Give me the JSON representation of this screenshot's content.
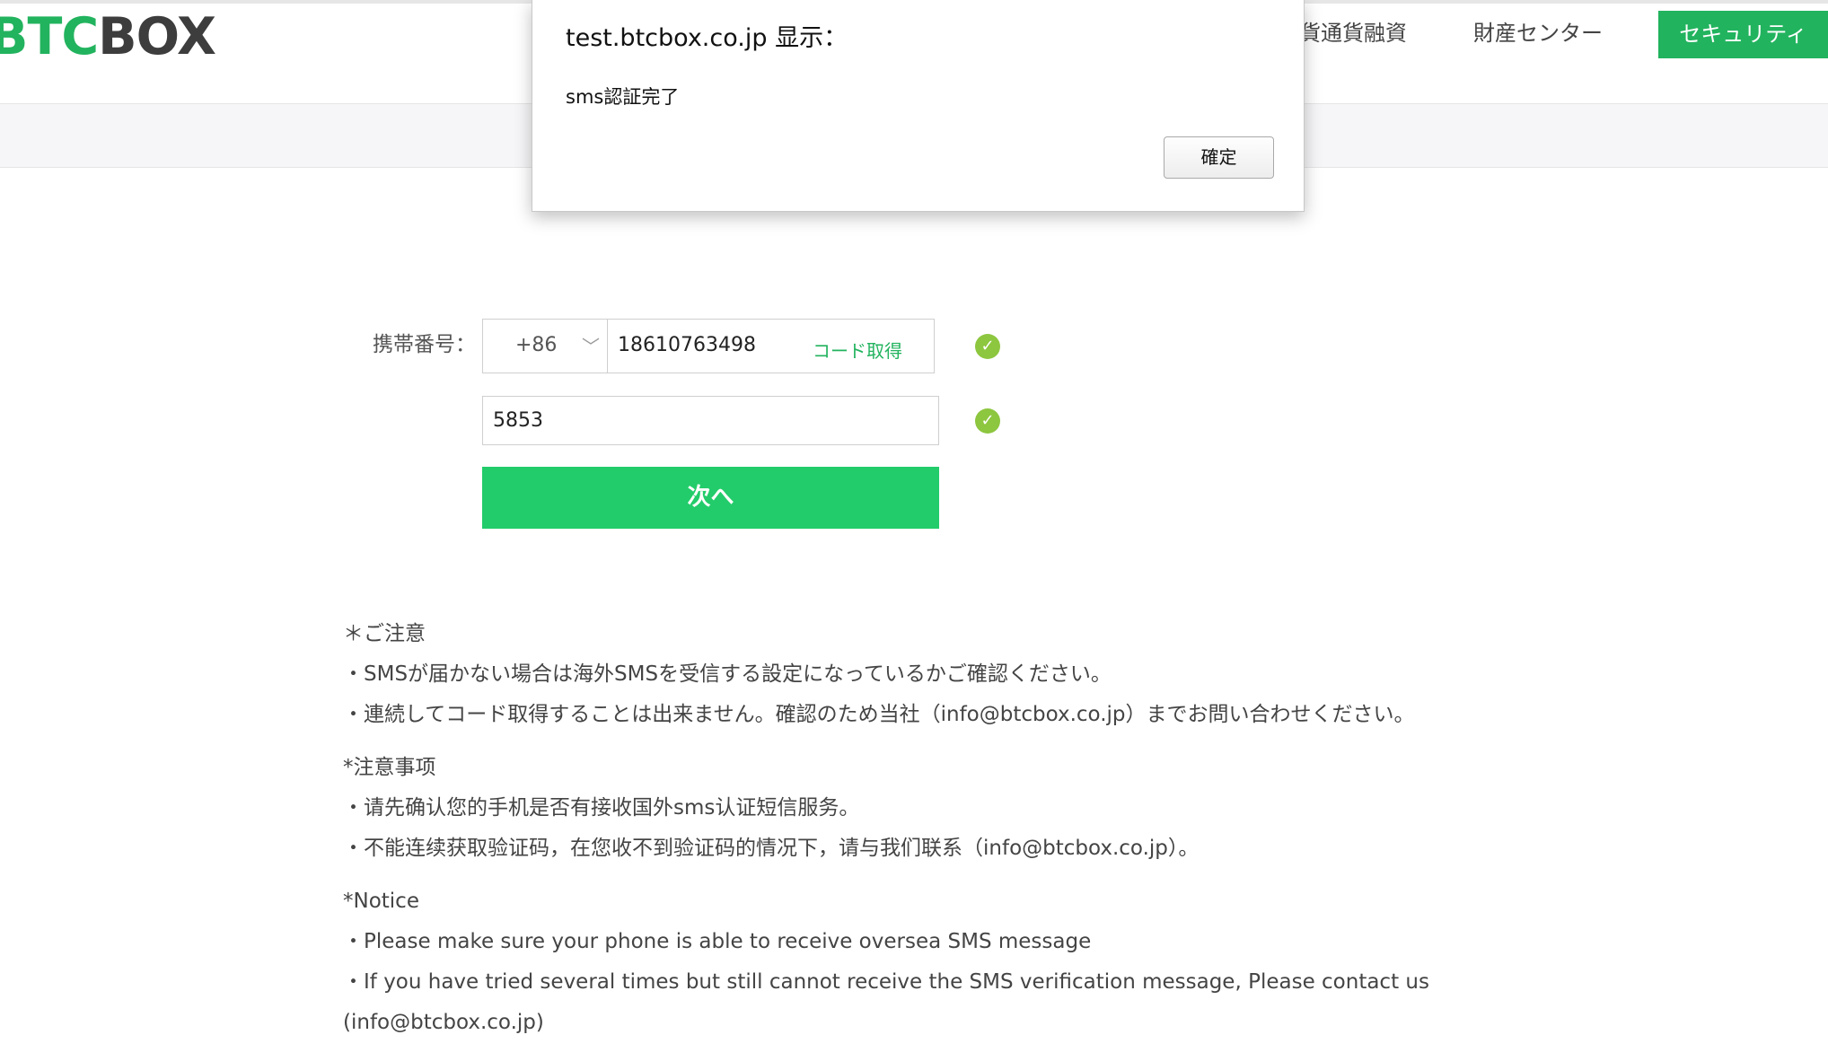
{
  "header": {
    "logo_prefix": "BTC",
    "logo_suffix": "BOX",
    "nav": {
      "item_crypto_loan": "貨通貨融資",
      "item_assets": "財産センター",
      "item_security": "セキュリティ"
    }
  },
  "form": {
    "phone_label": "携帯番号：",
    "country_code": "+86",
    "chevron": "﹀",
    "phone_number": "18610763498",
    "get_code_label": "コード取得",
    "verification_code": "5853",
    "check_icon": "✓",
    "next_label": "次へ"
  },
  "notes": {
    "jp_title": "＊ご注意",
    "jp_1": "・SMSが届かない場合は海外SMSを受信する設定になっているかご確認ください。",
    "jp_2": "・連続してコード取得することは出来ません。確認のため当社（info@btcbox.co.jp）までお問い合わせください。",
    "cn_title": "*注意事项",
    "cn_1": "・请先确认您的手机是否有接收国外sms认证短信服务。",
    "cn_2": "・不能连续获取验证码，在您收不到验证码的情况下，请与我们联系（info@btcbox.co.jp）。",
    "en_title": "*Notice",
    "en_1": "・Please make sure your phone is able to receive oversea SMS message",
    "en_2": "・If you have tried several times but still cannot receive the SMS verification message, Please contact us",
    "en_3": "(info@btcbox.co.jp)"
  },
  "dialog": {
    "title": "test.btcbox.co.jp 显示：",
    "message": "sms認証完了",
    "ok_label": "確定"
  },
  "colors": {
    "brand_green": "#22b35e",
    "button_green": "#22cc6a",
    "check_green": "#8dc63f"
  }
}
